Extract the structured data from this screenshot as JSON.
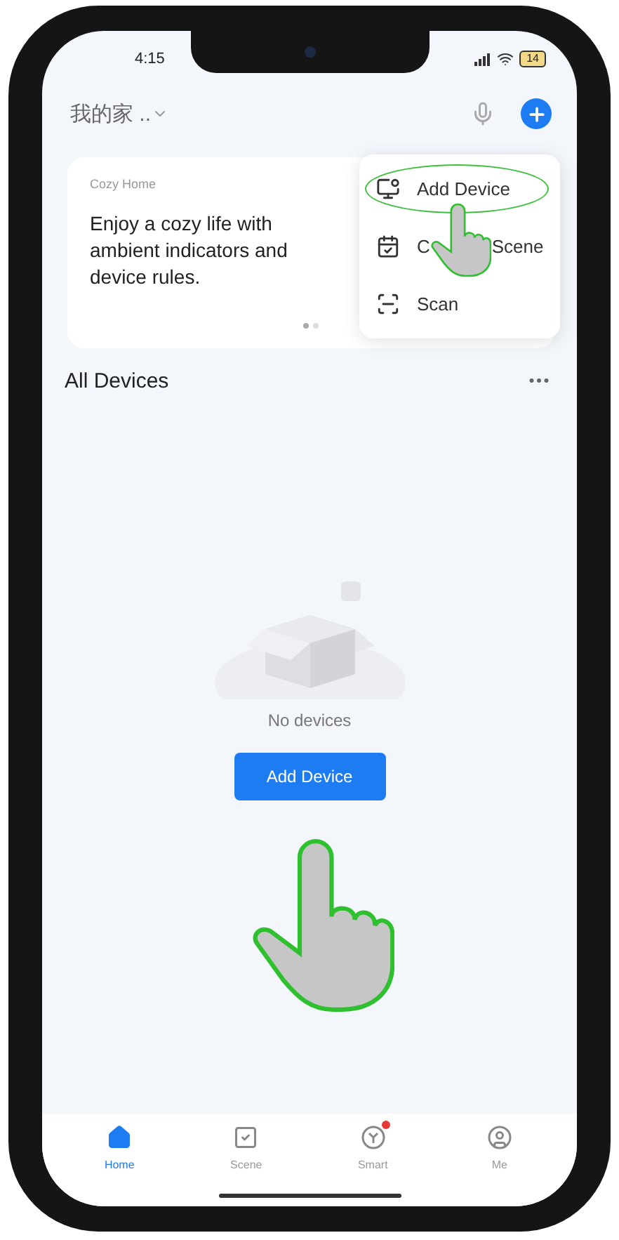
{
  "status_bar": {
    "time": "4:15",
    "battery": "14"
  },
  "header": {
    "home_name": "我的家 .."
  },
  "banner": {
    "label": "Cozy Home",
    "text": "Enjoy a cozy life with ambient indicators and device rules.",
    "pages": [
      {
        "selected": true
      },
      {
        "selected": false
      }
    ]
  },
  "menu": {
    "items": [
      {
        "kind": "add-device",
        "label": "Add Device",
        "highlighted": true
      },
      {
        "kind": "create-scene",
        "label": "C",
        "label_tail": "Scene",
        "highlighted": false
      },
      {
        "kind": "scan",
        "label": "Scan",
        "highlighted": false
      }
    ]
  },
  "section": {
    "title": "All Devices"
  },
  "empty_state": {
    "message": "No devices",
    "button": "Add Device"
  },
  "tabs": [
    {
      "kind": "home",
      "label": "Home",
      "selected": true,
      "badge": false
    },
    {
      "kind": "scene",
      "label": "Scene",
      "selected": false,
      "badge": false
    },
    {
      "kind": "smart",
      "label": "Smart",
      "selected": false,
      "badge": true
    },
    {
      "kind": "me",
      "label": "Me",
      "selected": false,
      "badge": false
    }
  ]
}
